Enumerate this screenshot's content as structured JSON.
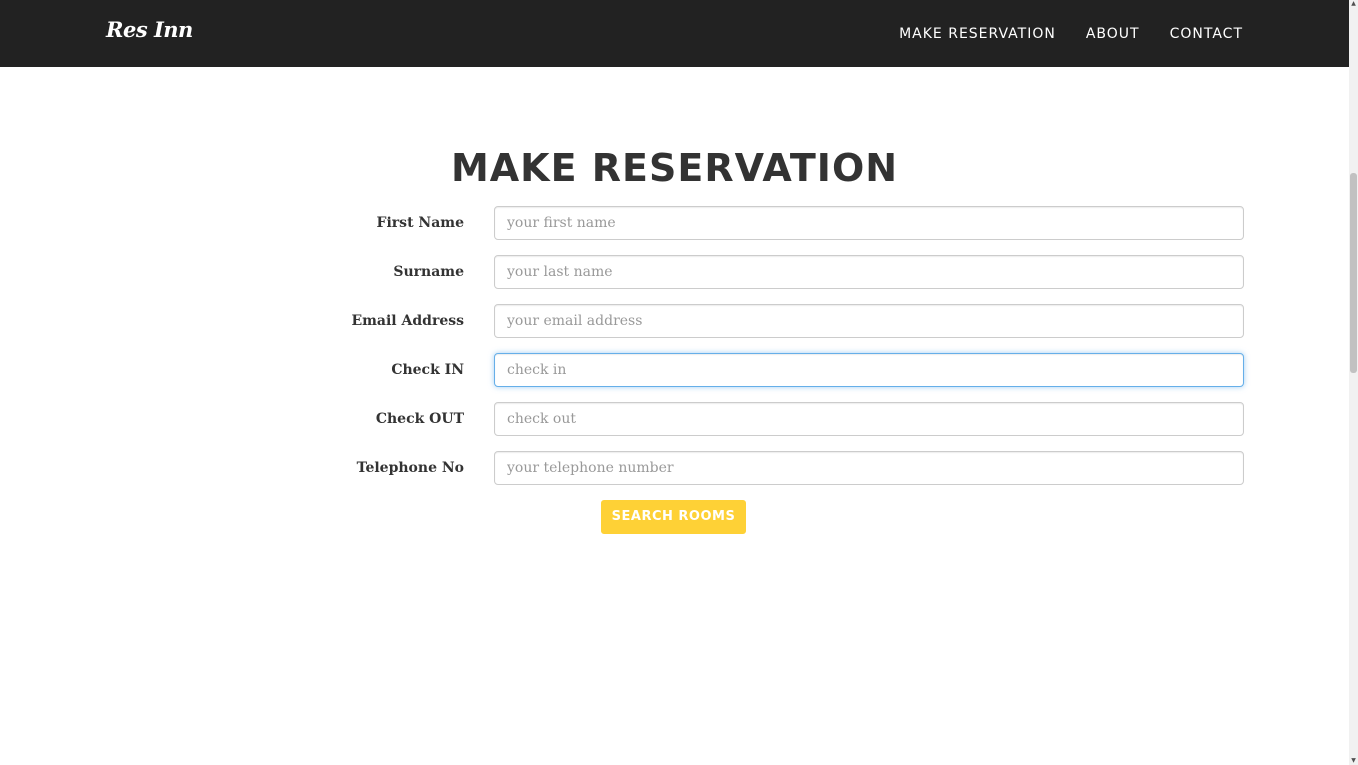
{
  "navbar": {
    "brand": "Res Inn",
    "links": [
      {
        "label": "MAKE RESERVATION"
      },
      {
        "label": "ABOUT"
      },
      {
        "label": "CONTACT"
      }
    ]
  },
  "main": {
    "title": "MAKE RESERVATION",
    "fields": [
      {
        "label": "First Name",
        "placeholder": "your first name",
        "value": ""
      },
      {
        "label": "Surname",
        "placeholder": "your last name",
        "value": ""
      },
      {
        "label": "Email Address",
        "placeholder": "your email address",
        "value": ""
      },
      {
        "label": "Check IN",
        "placeholder": "check in",
        "value": ""
      },
      {
        "label": "Check OUT",
        "placeholder": "check out",
        "value": ""
      },
      {
        "label": "Telephone No",
        "placeholder": "your telephone number",
        "value": ""
      }
    ],
    "submit_label": "SEARCH ROOMS"
  },
  "colors": {
    "navbar_bg": "#222222",
    "accent": "#fed136",
    "focus_border": "#66afe9",
    "heading_text": "#333333"
  }
}
